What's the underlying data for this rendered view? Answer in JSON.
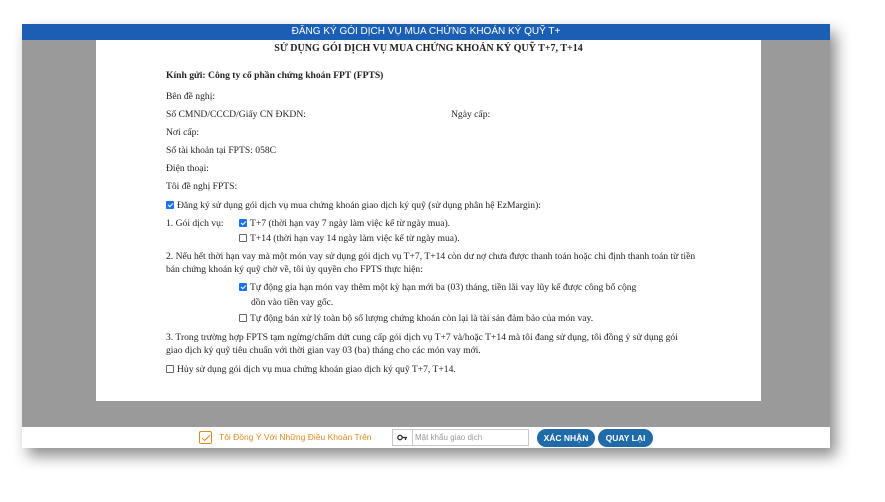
{
  "window": {
    "title": "ĐĂNG KÝ GÓI DỊCH VỤ MUA CHỨNG KHOÁN KÝ QUỸ T+"
  },
  "document": {
    "title": "SỬ DỤNG GÓI DỊCH VỤ MUA CHỨNG KHOÁN KÝ QUỸ T+7, T+14",
    "addressee": "Kính gửi: Công ty cổ phần chứng khoán FPT (FPTS)",
    "requester_label": "Bên đề nghị:",
    "id_label": "Số CMND/CCCD/Giấy CN ĐKDN:",
    "issue_date_label": "Ngày cấp:",
    "issue_place_label": "Nơi cấp:",
    "account_label": "Số tài khoản tại FPTS: 058C",
    "phone_label": "Điện thoại:",
    "request_label": "Tôi đề nghị FPTS:",
    "register_option": {
      "checked": true,
      "text": "Đăng ký sử dụng gói dịch vụ mua chứng khoán giao dịch ký quỹ (sử dụng phân hệ EzMargin):"
    },
    "package_label": "1. Gói dịch vụ:",
    "packages": [
      {
        "checked": true,
        "text": "T+7 (thời hạn vay 7 ngày làm việc kể từ ngày mua)."
      },
      {
        "checked": false,
        "text": "T+14 (thời hạn vay 14 ngày làm việc kể từ ngày mua)."
      }
    ],
    "clause2": "2. Nếu hết thời hạn vay mà một món vay sử dụng gói dịch vụ T+7, T+14 còn dư nợ chưa được thanh toán hoặc chi định thanh toán từ tiền bán chứng khoán ký quỹ chờ về, tôi ủy quyền cho FPTS thực hiện:",
    "clause2_options": [
      {
        "checked": true,
        "line1": "Tự động gia hạn món vay thêm một kỳ hạn mới ba (03) tháng, tiền lãi vay lũy kế được công bố cộng",
        "line2": "dồn vào tiền vay gốc."
      },
      {
        "checked": false,
        "line1": "Tự động bán xử lý toàn bộ số lượng chứng khoán còn lại là tài sản đảm bảo của món vay."
      }
    ],
    "clause3": "3. Trong trường hợp FPTS tạm ngừng/chấm dứt cung cấp gói dịch vụ T+7 và/hoặc T+14 mà tôi đang sử dụng, tôi đồng ý sử dụng gói giao dịch ký quỹ tiêu chuẩn với thời gian vay 03 (ba) tháng cho các món vay mới.",
    "cancel_option": {
      "checked": false,
      "text": "Hủy sử dụng gói dịch vụ mua chứng khoán giao dịch ký quỹ T+7, T+14."
    }
  },
  "footer": {
    "agree_checked": true,
    "agree_label": "Tôi Đồng Ý Với Những Điều Khoản Trên",
    "password_placeholder": "Mật khẩu giao dịch",
    "password_value": "",
    "key_icon": "key-icon",
    "confirm_label": "XÁC NHẬN",
    "back_label": "QUAY LẠI"
  },
  "colors": {
    "title_bar": "#1a5fb4",
    "button": "#1f6aa8",
    "agree_accent": "#e08a1e",
    "checkbox_checked": "#1a73e8",
    "backdrop": "#9a9a9a"
  }
}
